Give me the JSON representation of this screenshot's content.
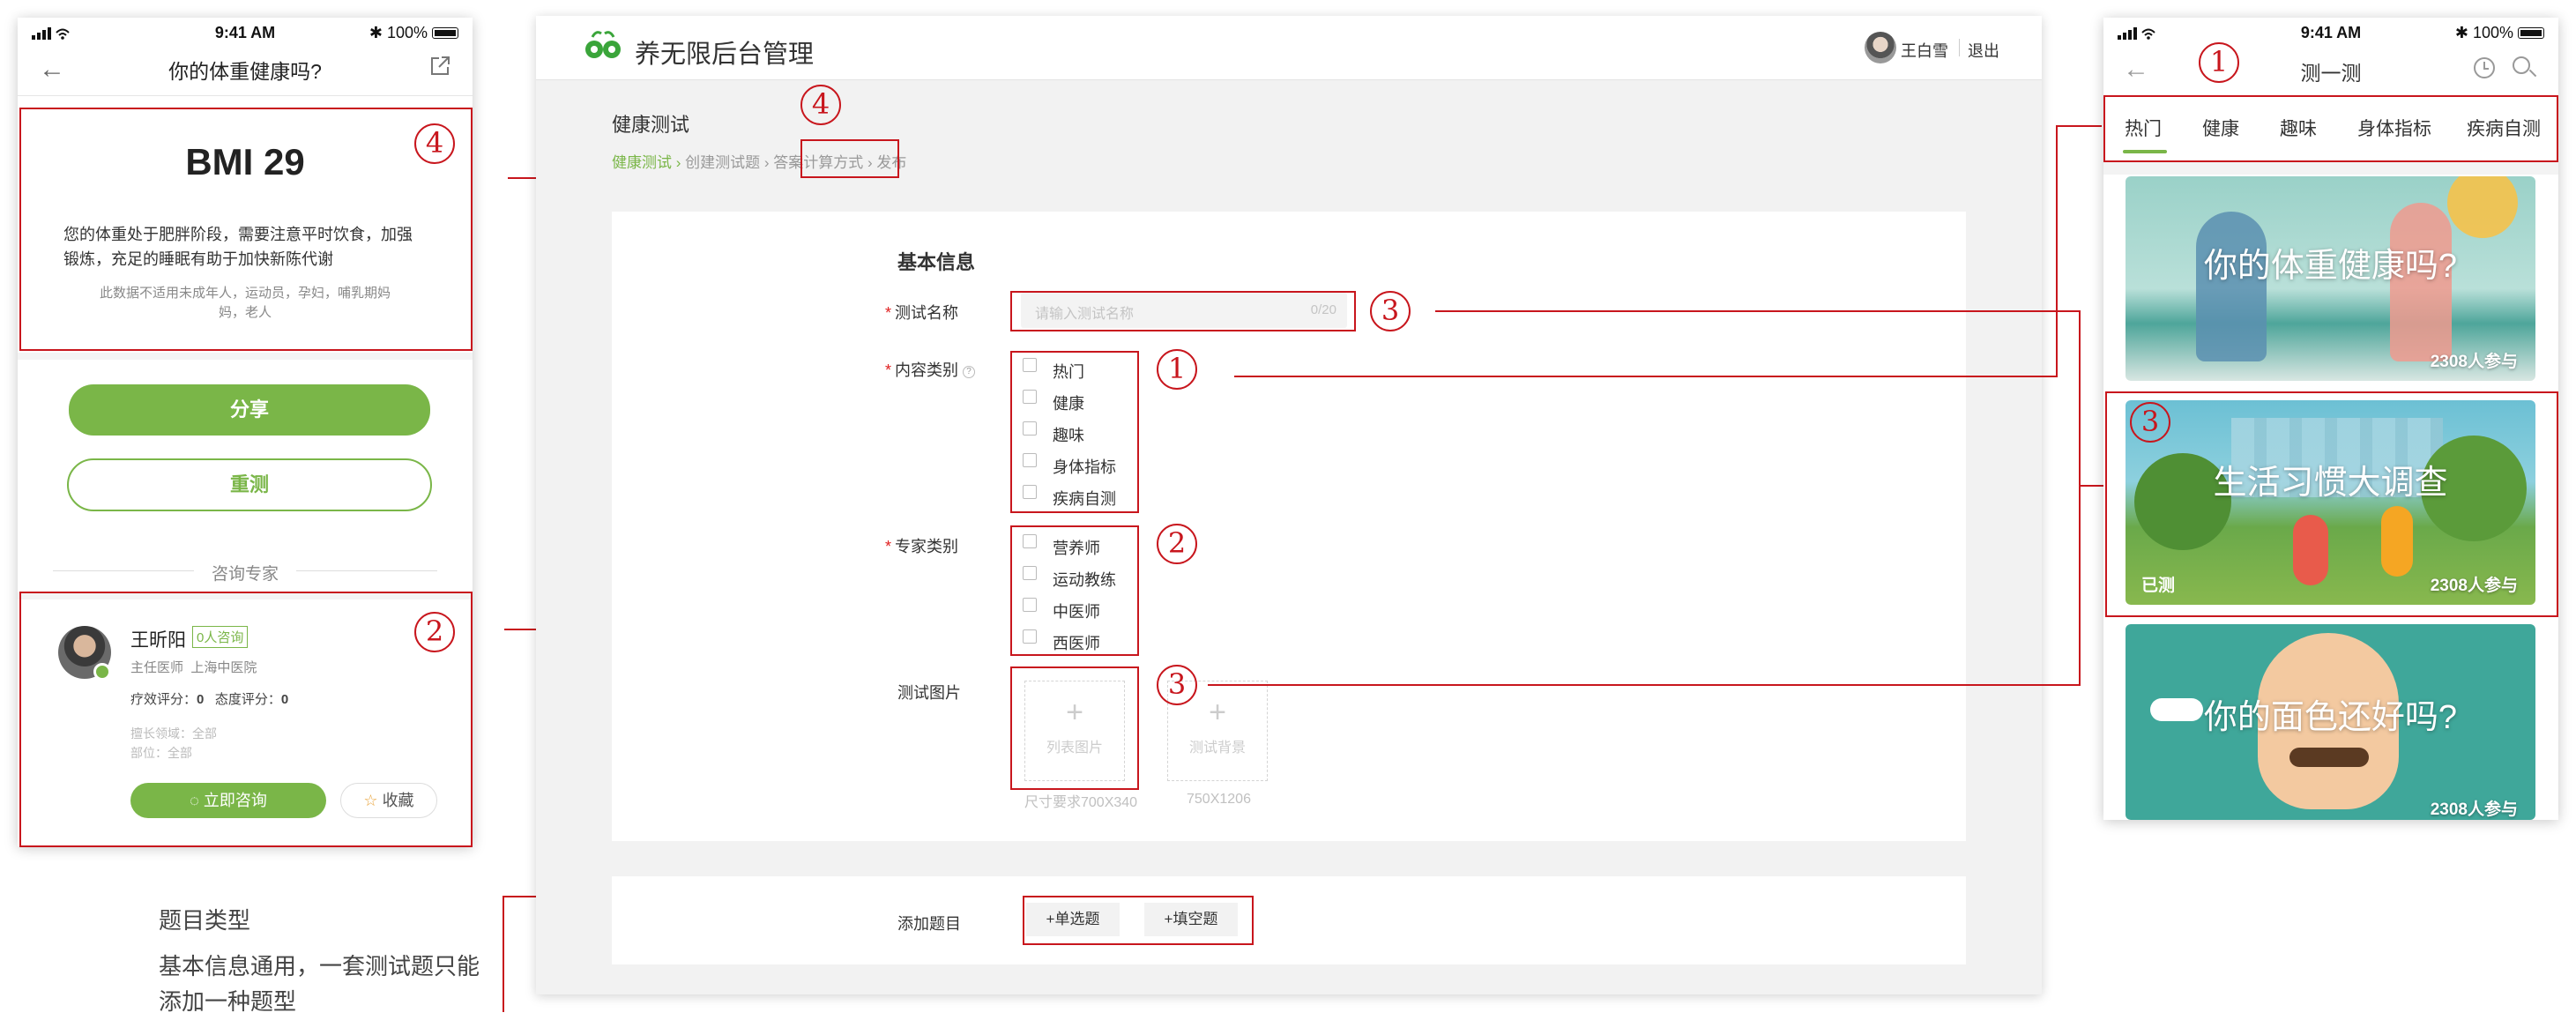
{
  "left_phone": {
    "status": {
      "time": "9:41 AM",
      "battery": "100%"
    },
    "nav_title": "你的体重健康吗?",
    "bmi_title": "BMI 29",
    "bmi_text": "您的体重处于肥胖阶段，需要注意平时饮食，加强锻炼，充足的睡眠有助于加快新陈代谢",
    "bmi_note": "此数据不适用未成年人，运动员，孕妇，哺乳期妈妈，老人",
    "share_button": "分享",
    "retest_button": "重测",
    "consult_divider": "咨询专家",
    "expert": {
      "name": "王昕阳",
      "badge": "0人咨询",
      "title": "主任医师",
      "hospital": "上海中医院",
      "score1": "疗效评分：",
      "score1_val": "0",
      "score2": "态度评分：",
      "score2_val": "0",
      "field": "擅长领域：全部",
      "dept": "部位：全部",
      "consult_button": "立即咨询",
      "fav_button": "收藏"
    }
  },
  "annotation": {
    "title": "题目类型",
    "text": "基本信息通用，一套测试题只能添加一种题型"
  },
  "admin": {
    "app_title": "养无限后台管理",
    "user_name": "王白雪",
    "logout": "退出",
    "page_title": "健康测试",
    "steps": [
      "健康测试",
      "创建测试题",
      "答案计算方式",
      "发布"
    ],
    "section_title": "基本信息",
    "name_label": "测试名称",
    "name_placeholder": "请输入测试名称",
    "name_counter": "0/20",
    "content_label": "内容类别",
    "content_options": [
      "热门",
      "健康",
      "趣味",
      "身体指标",
      "疾病自测"
    ],
    "expert_label": "专家类别",
    "expert_options": [
      "营养师",
      "运动教练",
      "中医师",
      "西医师"
    ],
    "image_label": "测试图片",
    "upload_list": "列表图片",
    "upload_bg": "测试背景",
    "size_hint1": "尺寸要求700X340",
    "size_hint2": "750X1206",
    "add_label": "添加题目",
    "add_single": "+单选题",
    "add_fill": "+填空题"
  },
  "right_phone": {
    "status": {
      "time": "9:41 AM",
      "battery": "100%"
    },
    "nav_title": "测一测",
    "tabs": [
      "热门",
      "健康",
      "趣味",
      "身体指标",
      "疾病自测"
    ],
    "cards": [
      {
        "title": "你的体重健康吗?",
        "count": "2308人参与",
        "tag": ""
      },
      {
        "title": "生活习惯大调查",
        "count": "2308人参与",
        "tag": "已测"
      },
      {
        "title": "你的面色还好吗?",
        "count": "2308人参与",
        "tag": ""
      }
    ]
  },
  "markers": {
    "one": "1",
    "two": "2",
    "three": "3",
    "four": "4"
  },
  "colors": {
    "accent": "#7ab648",
    "annotation_red": "#c8161d"
  }
}
